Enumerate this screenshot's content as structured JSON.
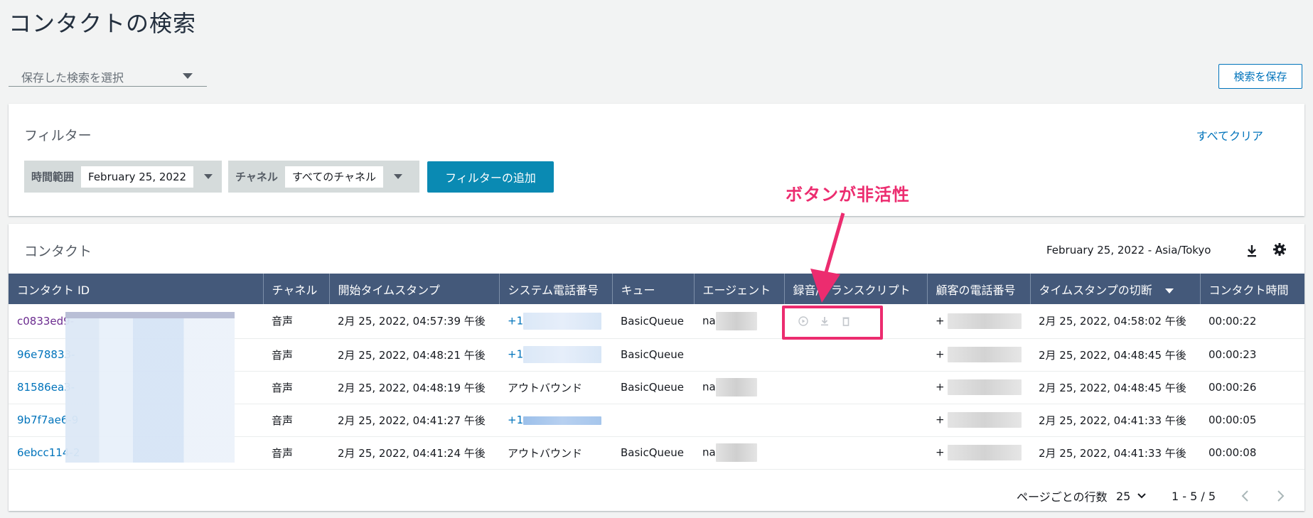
{
  "page": {
    "title": "コンタクトの検索"
  },
  "saved_search": {
    "placeholder": "保存した検索を選択"
  },
  "header_actions": {
    "save_search_label": "検索を保存"
  },
  "filters": {
    "title": "フィルター",
    "clear_all_label": "すべてクリア",
    "time_range": {
      "label": "時間範囲",
      "value": "February 25, 2022"
    },
    "channel": {
      "label": "チャネル",
      "value": "すべてのチャネル"
    },
    "add_filter_label": "フィルターの追加"
  },
  "contacts": {
    "title": "コンタクト",
    "date_timezone": "February 25, 2022 - Asia/Tokyo",
    "columns": [
      "コンタクト ID",
      "チャネル",
      "開始タイムスタンプ",
      "システム電話番号",
      "キュー",
      "エージェント",
      "録音/トランスクリプト",
      "顧客の電話番号",
      "タイムスタンプの切断",
      "コンタクト時間"
    ],
    "rows": [
      {
        "id": "c0833ed9-",
        "channel": "音声",
        "start": "2月 25, 2022, 04:57:39 午後",
        "system_phone": "+1",
        "queue": "BasicQueue",
        "agent": "na",
        "customer_phone": "+",
        "disconnect": "2月 25, 2022, 04:58:02 午後",
        "duration": "00:00:22"
      },
      {
        "id": "96e78833-",
        "channel": "音声",
        "start": "2月 25, 2022, 04:48:21 午後",
        "system_phone": "+1",
        "queue": "BasicQueue",
        "agent": "",
        "customer_phone": "+",
        "disconnect": "2月 25, 2022, 04:48:45 午後",
        "duration": "00:00:23"
      },
      {
        "id": "81586ea3-",
        "channel": "音声",
        "start": "2月 25, 2022, 04:48:19 午後",
        "system_phone": "アウトバウンド",
        "queue": "BasicQueue",
        "agent": "na",
        "customer_phone": "+",
        "disconnect": "2月 25, 2022, 04:48:45 午後",
        "duration": "00:00:26"
      },
      {
        "id": "9b7f7ae6-9",
        "channel": "音声",
        "start": "2月 25, 2022, 04:41:27 午後",
        "system_phone": "+1",
        "queue": "",
        "agent": "",
        "customer_phone": "+",
        "disconnect": "2月 25, 2022, 04:41:33 午後",
        "duration": "00:00:05"
      },
      {
        "id": "6ebcc114-2",
        "channel": "音声",
        "start": "2月 25, 2022, 04:41:24 午後",
        "system_phone": "アウトバウンド",
        "queue": "BasicQueue",
        "agent": "na",
        "customer_phone": "+",
        "disconnect": "2月 25, 2022, 04:41:33 午後",
        "duration": "00:00:08"
      }
    ]
  },
  "annotation": {
    "text": "ボタンが非活性",
    "color": "#ec2c6f"
  },
  "pagination": {
    "rows_per_page_label": "ページごとの行数",
    "rows_per_page_value": "25",
    "range": "1 - 5 / 5"
  },
  "colors": {
    "accent": "#0073bb",
    "header_bg": "#44597a",
    "primary_button": "#0a8ab3"
  }
}
